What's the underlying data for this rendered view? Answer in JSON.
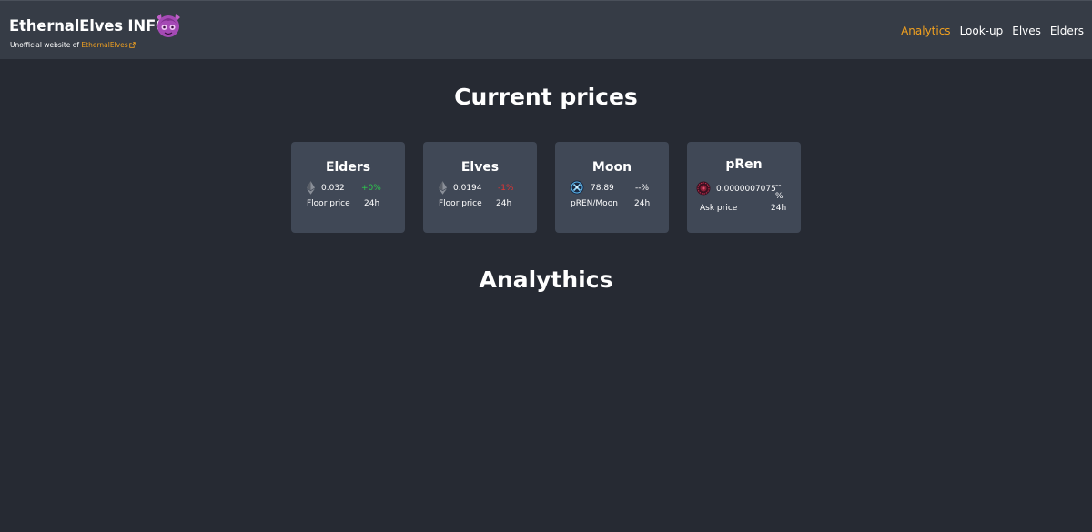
{
  "navbar": {
    "brand": "EthernalElves INFO",
    "subtitle_prefix": "Unofficial website of",
    "subtitle_link": "EthernalElves",
    "links": [
      {
        "label": "Analytics",
        "active": true
      },
      {
        "label": "Look-up"
      },
      {
        "label": "Elves"
      },
      {
        "label": "Elders"
      }
    ],
    "accent_color": "#f0a020"
  },
  "main": {
    "prices_title": "Current prices",
    "analytics_title": "Analythics",
    "cards": [
      {
        "title": "Elders",
        "value": "0.032",
        "change": "+0%",
        "change_color": "#2dc84d",
        "label": "Floor price",
        "period": "24h",
        "icon": "ethereum-icon"
      },
      {
        "title": "Elves",
        "value": "0.0194",
        "change": "-1%",
        "change_color": "#e03434",
        "label": "Floor price",
        "period": "24h",
        "icon": "ethereum-icon"
      },
      {
        "title": "Moon",
        "value": "78.89",
        "change": "--%",
        "label": "pREN/Moon",
        "period": "24h",
        "icon": "moon-token-icon"
      },
      {
        "title": "pRen",
        "value": "0.0000007075",
        "change": "--%",
        "label": "Ask price",
        "period": "24h",
        "icon": "pren-token-icon"
      }
    ]
  }
}
